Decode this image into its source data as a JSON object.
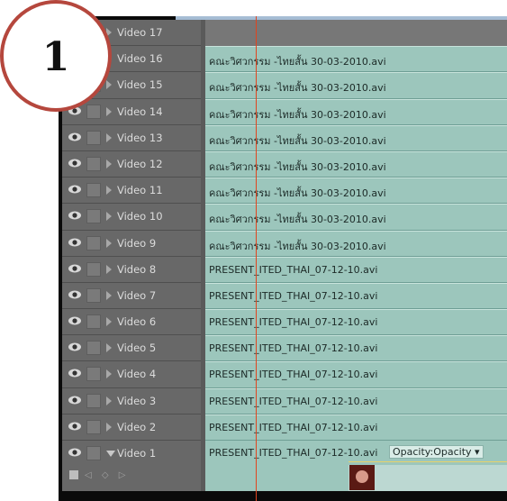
{
  "badge": {
    "number": "1"
  },
  "timeline": {
    "tracks": [
      {
        "name": "Video 17",
        "clip": ""
      },
      {
        "name": "Video 16",
        "clip": "คณะวิศวกรรม -ไทยสั้น 30-03-2010.avi"
      },
      {
        "name": "Video 15",
        "clip": "คณะวิศวกรรม -ไทยสั้น 30-03-2010.avi"
      },
      {
        "name": "Video 14",
        "clip": "คณะวิศวกรรม -ไทยสั้น 30-03-2010.avi"
      },
      {
        "name": "Video 13",
        "clip": "คณะวิศวกรรม -ไทยสั้น 30-03-2010.avi"
      },
      {
        "name": "Video 12",
        "clip": "คณะวิศวกรรม -ไทยสั้น 30-03-2010.avi"
      },
      {
        "name": "Video 11",
        "clip": "คณะวิศวกรรม -ไทยสั้น 30-03-2010.avi"
      },
      {
        "name": "Video 10",
        "clip": "คณะวิศวกรรม -ไทยสั้น 30-03-2010.avi"
      },
      {
        "name": "Video 9",
        "clip": "คณะวิศวกรรม -ไทยสั้น 30-03-2010.avi"
      },
      {
        "name": "Video 8",
        "clip": "PRESENT_ITED_THAI_07-12-10.avi"
      },
      {
        "name": "Video 7",
        "clip": "PRESENT_ITED_THAI_07-12-10.avi"
      },
      {
        "name": "Video 6",
        "clip": "PRESENT_ITED_THAI_07-12-10.avi"
      },
      {
        "name": "Video 5",
        "clip": "PRESENT_ITED_THAI_07-12-10.avi"
      },
      {
        "name": "Video 4",
        "clip": "PRESENT_ITED_THAI_07-12-10.avi"
      },
      {
        "name": "Video 3",
        "clip": "PRESENT_ITED_THAI_07-12-10.avi"
      },
      {
        "name": "Video 2",
        "clip": "PRESENT_ITED_THAI_07-12-10.avi"
      }
    ],
    "video1": {
      "name": "Video 1",
      "clip": "PRESENT_ITED_THAI_07-12-10.avi",
      "opacity_menu": "Opacity:Opacity ▾",
      "keyframe_nav": "◁ ◇ ▷"
    },
    "colors": {
      "clip": "#9cc6bc",
      "playhead": "#e0451f",
      "header": "#686868"
    }
  }
}
